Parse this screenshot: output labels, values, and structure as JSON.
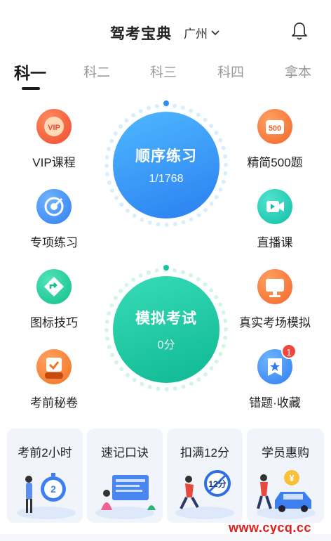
{
  "header": {
    "title": "驾考宝典",
    "city": "广州"
  },
  "tabs": [
    {
      "label": "科一",
      "active": true
    },
    {
      "label": "科二",
      "active": false
    },
    {
      "label": "科三",
      "active": false
    },
    {
      "label": "科四",
      "active": false
    },
    {
      "label": "拿本",
      "active": false
    }
  ],
  "features_left": [
    {
      "label": "VIP课程",
      "icon": "vip-icon",
      "color": "#f2573c"
    },
    {
      "label": "专项练习",
      "icon": "target-icon",
      "color": "#3d8ff5"
    },
    {
      "label": "图标技巧",
      "icon": "road-sign-icon",
      "color": "#1fc89a"
    },
    {
      "label": "考前秘卷",
      "icon": "exam-paper-icon",
      "color": "#f2823c"
    }
  ],
  "features_right": [
    {
      "label": "精简500题",
      "icon": "500-icon",
      "color": "#f2773c"
    },
    {
      "label": "直播课",
      "icon": "video-icon",
      "color": "#1fc7b0"
    },
    {
      "label": "真实考场模拟",
      "icon": "monitor-icon",
      "color": "#f2773c"
    },
    {
      "label": "错题·收藏",
      "icon": "star-book-icon",
      "color": "#3d8ff5",
      "badge": "1"
    }
  ],
  "practice": {
    "title": "顺序练习",
    "progress": "1/1768",
    "progress_fraction": 0.000566
  },
  "mock_exam": {
    "title": "模拟考试",
    "score": "0分"
  },
  "cards": [
    {
      "title": "考前2小时",
      "badge_text": "2"
    },
    {
      "title": "速记口诀"
    },
    {
      "title": "扣满12分",
      "badge_text": "12分"
    },
    {
      "title": "学员惠购",
      "badge_text": "¥"
    }
  ],
  "watermark": "www.cycq.cc",
  "colors": {
    "practice": "#2e8ff0",
    "mock": "#17c4a0",
    "accent_red": "#f0483e"
  }
}
